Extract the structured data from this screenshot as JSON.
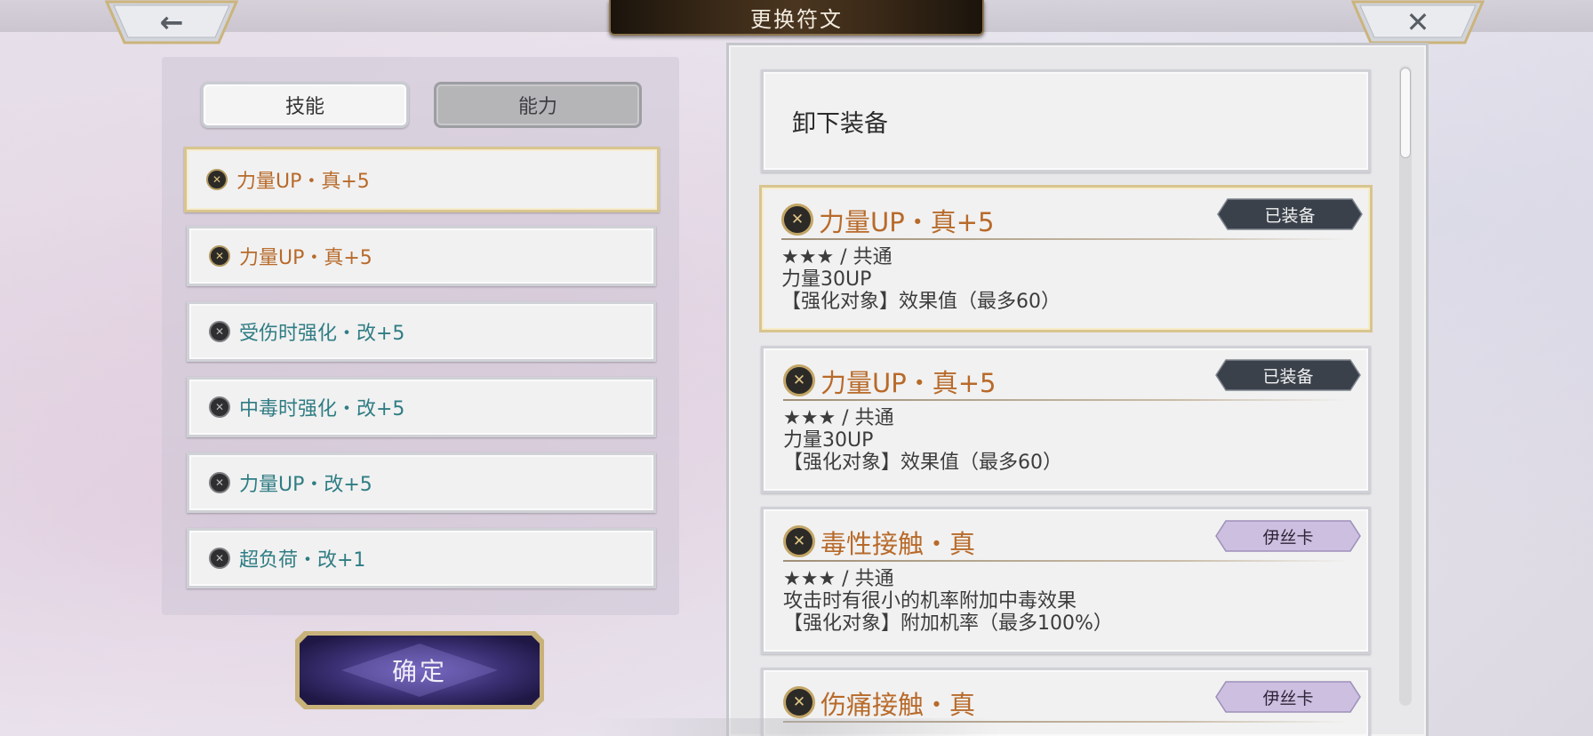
{
  "header": {
    "title": "更换符文",
    "back_icon": "←",
    "close_icon": "✕"
  },
  "left_panel": {
    "tabs": [
      {
        "label": "技能",
        "active": true
      },
      {
        "label": "能力",
        "active": false
      }
    ],
    "runes": [
      {
        "name": "力量UP・真+5",
        "icon": "gold-rune-icon",
        "color": "orange",
        "selected": true
      },
      {
        "name": "力量UP・真+5",
        "icon": "gold-rune-icon",
        "color": "orange",
        "selected": false
      },
      {
        "name": "受伤时强化・改+5",
        "icon": "grey-rune-icon",
        "color": "teal",
        "selected": false
      },
      {
        "name": "中毒时强化・改+5",
        "icon": "grey-rune-icon",
        "color": "teal",
        "selected": false
      },
      {
        "name": "力量UP・改+5",
        "icon": "grey-rune-icon",
        "color": "teal",
        "selected": false
      },
      {
        "name": "超负荷・改+1",
        "icon": "grey-rune-icon",
        "color": "teal",
        "selected": false
      }
    ],
    "confirm_label": "确定"
  },
  "right_panel": {
    "unequip_label": "卸下装备",
    "cards": [
      {
        "title": "力量UP・真+5",
        "badge": "已装备",
        "badge_style": "dark",
        "lines": [
          "★★★ / 共通",
          "力量30UP",
          "【强化对象】效果值（最多60）"
        ],
        "selected": true
      },
      {
        "title": "力量UP・真+5",
        "badge": "已装备",
        "badge_style": "dark",
        "lines": [
          "★★★ / 共通",
          "力量30UP",
          "【强化对象】效果值（最多60）"
        ],
        "selected": false
      },
      {
        "title": "毒性接触・真",
        "badge": "伊丝卡",
        "badge_style": "purple",
        "lines": [
          "★★★ / 共通",
          "攻击时有很小的机率附加中毒效果",
          "【强化对象】附加机率（最多100%）"
        ],
        "selected": false
      },
      {
        "title": "伤痛接触・真",
        "badge": "伊丝卡",
        "badge_style": "purple",
        "lines": [],
        "selected": false
      }
    ]
  },
  "colors": {
    "rune_orange": "#b86a2a",
    "rune_teal": "#2f7d84",
    "selected_border": "#d8c58e",
    "badge_dark": "#3a414a",
    "badge_purple": "#cdbfe0",
    "confirm_purple": "#3a2f72"
  }
}
